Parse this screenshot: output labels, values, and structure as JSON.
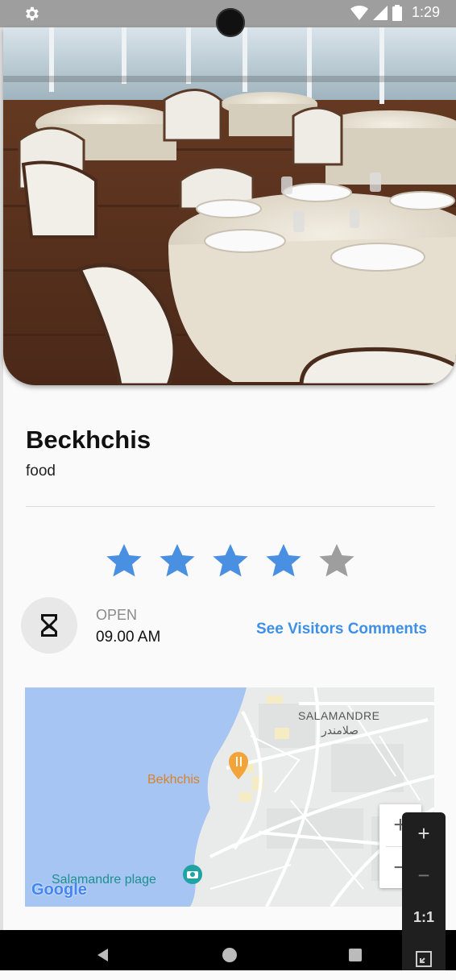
{
  "status_bar": {
    "time": "1:29"
  },
  "place": {
    "name": "Beckhchis",
    "category": "food"
  },
  "rating": {
    "value": 4,
    "max": 5,
    "filled_color": "#4a90e2",
    "empty_color": "#9e9e9e"
  },
  "hours": {
    "status": "OPEN",
    "time": "09.00 AM"
  },
  "actions": {
    "see_comments": "See Visitors Comments"
  },
  "map": {
    "area_label_latin": "SALAMANDRE",
    "area_label_arabic": "صلامندر",
    "marker_label": "Bekhchis",
    "poi_label": "Salamandre plage",
    "logo": "Google",
    "zoom_in": "+",
    "zoom_out": "−"
  },
  "emulator_controls": {
    "zoom_in": "+",
    "zoom_out": "−",
    "one_to_one": "1:1"
  },
  "colors": {
    "accent": "#3e8fe6",
    "water": "#a6c5f2",
    "marker": "#f2a33a"
  }
}
